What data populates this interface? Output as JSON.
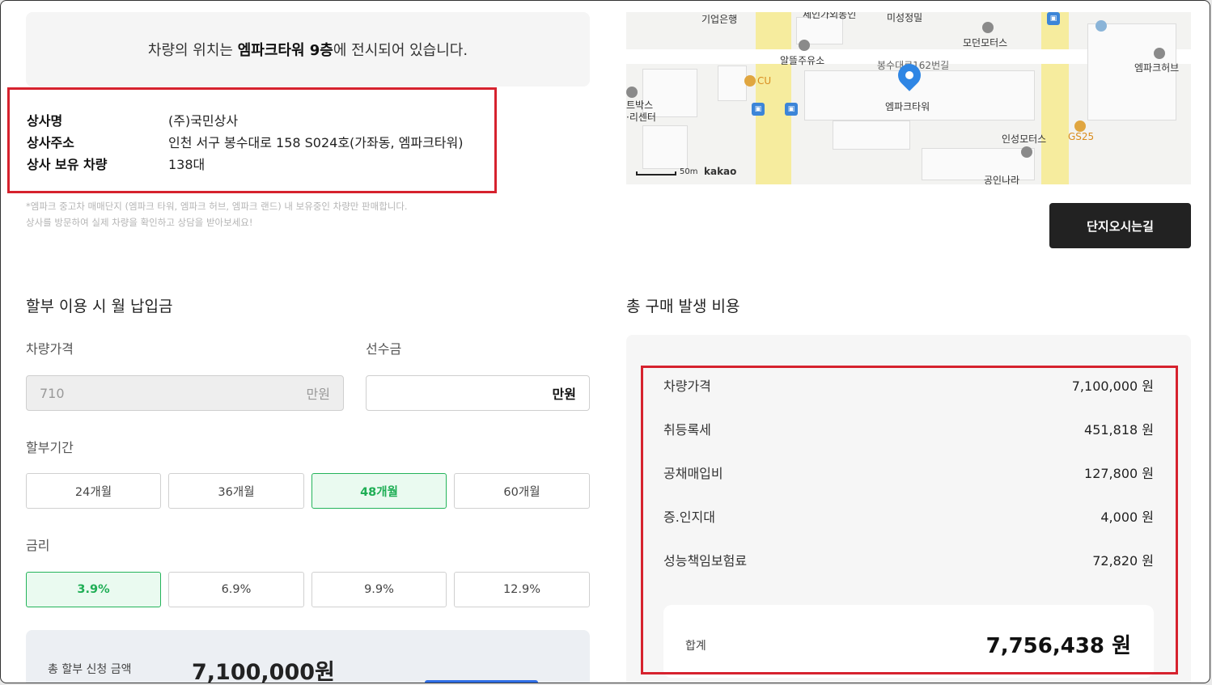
{
  "location_notice": {
    "prefix": "차량의 위치는 ",
    "place": "엠파크타워 9층",
    "suffix": "에 전시되어 있습니다."
  },
  "dealer": {
    "name_label": "상사명",
    "name_value": "(주)국민상사",
    "address_label": "상사주소",
    "address_value": "인천 서구 봉수대로 158 S024호(가좌동, 엠파크타워)",
    "vehicles_label": "상사 보유 차량",
    "vehicles_value": "138대"
  },
  "fine_print": {
    "line1": "*엠파크 중고차 매매단지 (엠파크 타워, 엠파크 허브, 엠파크 랜드) 내 보유중인 차량만 판매합니다.",
    "line2": "상사를 방문하여 실제 차량을 확인하고 상담을 받아보세요!"
  },
  "map": {
    "labels": {
      "ibk": "기업은행",
      "top_cut": "세인가외동인",
      "misung": "미성정밀",
      "modern": "모던모터스",
      "empark_hub": "엠파크허브",
      "altteul": "알뜰주유소",
      "road": "봉수대로162번길",
      "cu": "CU",
      "tower": "엠파크타워",
      "textbox1": "트박스",
      "textbox2": "·리센터",
      "inseong": "인성모터스",
      "gs25": "GS25",
      "gongin": "공인나라",
      "scale": "50m",
      "kakao": "kakao"
    },
    "colors": {
      "road": "#f6ec9e",
      "pin": "#2f86e4",
      "bus": "#3c85d8"
    }
  },
  "directions_button": "단지오시는길",
  "installment": {
    "title": "할부 이용 시 월 납입금",
    "price_label": "차량가격",
    "price_value": "710",
    "price_unit": "만원",
    "down_label": "선수금",
    "down_value": "",
    "down_unit": "만원",
    "period_label": "할부기간",
    "periods": [
      "24개월",
      "36개월",
      "48개월",
      "60개월"
    ],
    "selected_period": "48개월",
    "rate_label": "금리",
    "rates": [
      "3.9%",
      "6.9%",
      "9.9%",
      "12.9%"
    ],
    "selected_rate": "3.9%",
    "summary_label": "총 할부 신청 금액",
    "summary_amount": "7,100,000원"
  },
  "costs": {
    "title": "총 구매 발생 비용",
    "rows": [
      {
        "label": "차량가격",
        "value": "7,100,000 원"
      },
      {
        "label": "취등록세",
        "value": "451,818 원"
      },
      {
        "label": "공채매입비",
        "value": "127,800 원"
      },
      {
        "label": "증.인지대",
        "value": "4,000 원"
      },
      {
        "label": "성능책임보험료",
        "value": "72,820 원"
      }
    ],
    "total_label": "합계",
    "total_value": "7,756,438 원"
  },
  "accent_colors": {
    "highlight": "#d6222e",
    "selected": "#24b45a"
  }
}
